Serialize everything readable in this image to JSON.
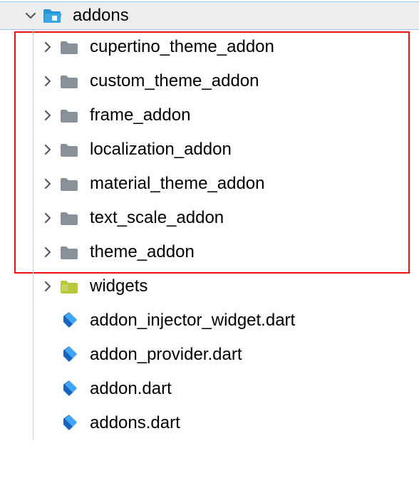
{
  "root": {
    "label": "addons"
  },
  "highlighted": [
    {
      "label": "cupertino_theme_addon"
    },
    {
      "label": "custom_theme_addon"
    },
    {
      "label": "frame_addon"
    },
    {
      "label": "localization_addon"
    },
    {
      "label": "material_theme_addon"
    },
    {
      "label": "text_scale_addon"
    },
    {
      "label": "theme_addon"
    }
  ],
  "other_folders": [
    {
      "label": "widgets"
    }
  ],
  "files": [
    {
      "label": "addon_injector_widget.dart"
    },
    {
      "label": "addon_provider.dart"
    },
    {
      "label": "addon.dart"
    },
    {
      "label": "addons.dart"
    }
  ]
}
